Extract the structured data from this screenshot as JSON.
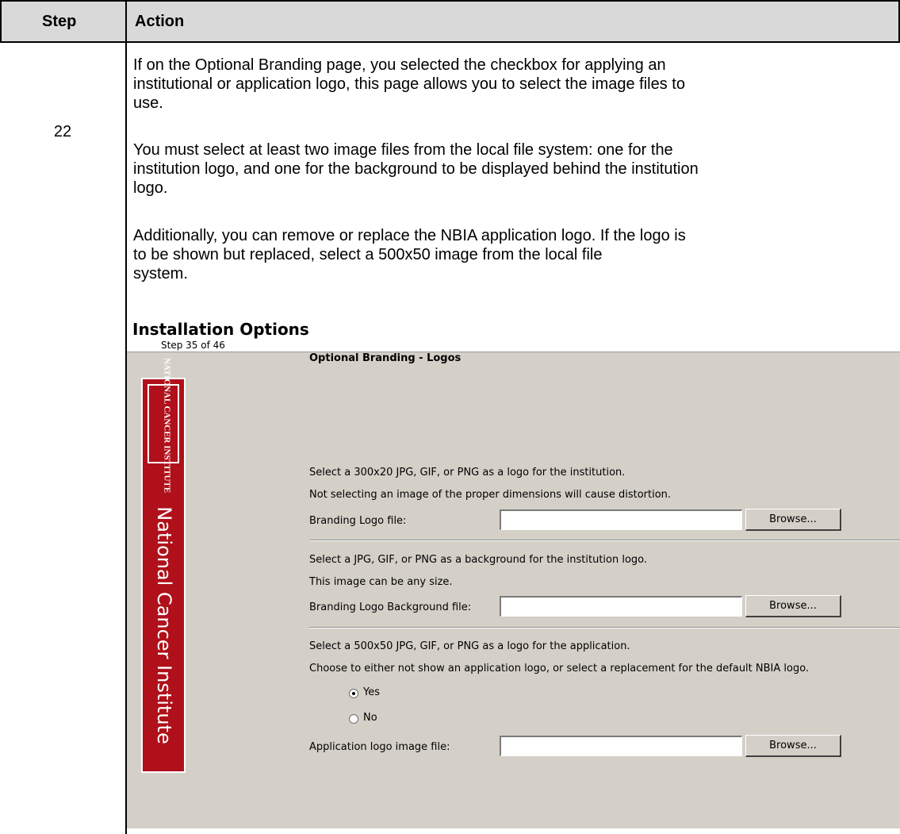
{
  "table": {
    "headers": {
      "step": "Step",
      "action": "Action"
    },
    "step_number": "22",
    "paragraphs": [
      [
        "If on the Optional Branding page, you selected the checkbox for applying an",
        "institutional or application logo, this page allows you to select the image files to",
        "use."
      ],
      [
        "You must select at least two image files from the local file system: one for the",
        "institution logo, and one for the background to be displayed behind the institution",
        "logo."
      ],
      [
        "Additionally, you can remove or replace the NBIA application logo.  If the logo is",
        "to be shown but replaced, select a 500x50 image from the local file",
        "system."
      ]
    ]
  },
  "screenshot": {
    "title": "Installation Options",
    "step_counter": "Step 35 of 46",
    "sidebar": {
      "logo_lines": [
        "NATIONAL",
        "CANCER",
        "INSTITUTE"
      ],
      "org_name": "National Cancer Institute",
      "color": "#b0101a"
    },
    "section_heading": "Optional Branding - Logos",
    "branding_logo": {
      "hint1": "Select a 300x20 JPG, GIF, or PNG as a logo for the institution.",
      "hint2": "Not selecting an image of the proper dimensions will cause distortion.",
      "label": "Branding Logo file:",
      "value": "",
      "browse_label": "Browse..."
    },
    "background": {
      "hint1": "Select a JPG, GIF, or PNG as a background for the institution logo.",
      "hint2": "This image can be any size.",
      "label": "Branding Logo Background file:",
      "value": "",
      "browse_label": "Browse..."
    },
    "application_logo": {
      "hint1": "Select a 500x50 JPG, GIF, or PNG as a logo for the application.",
      "hint2": "Choose to either not show an application logo, or select a replacement for the default NBIA logo.",
      "radio_yes": "Yes",
      "radio_no": "No",
      "selected": "Yes",
      "label": "Application logo image file:",
      "value": "",
      "browse_label": "Browse..."
    }
  }
}
